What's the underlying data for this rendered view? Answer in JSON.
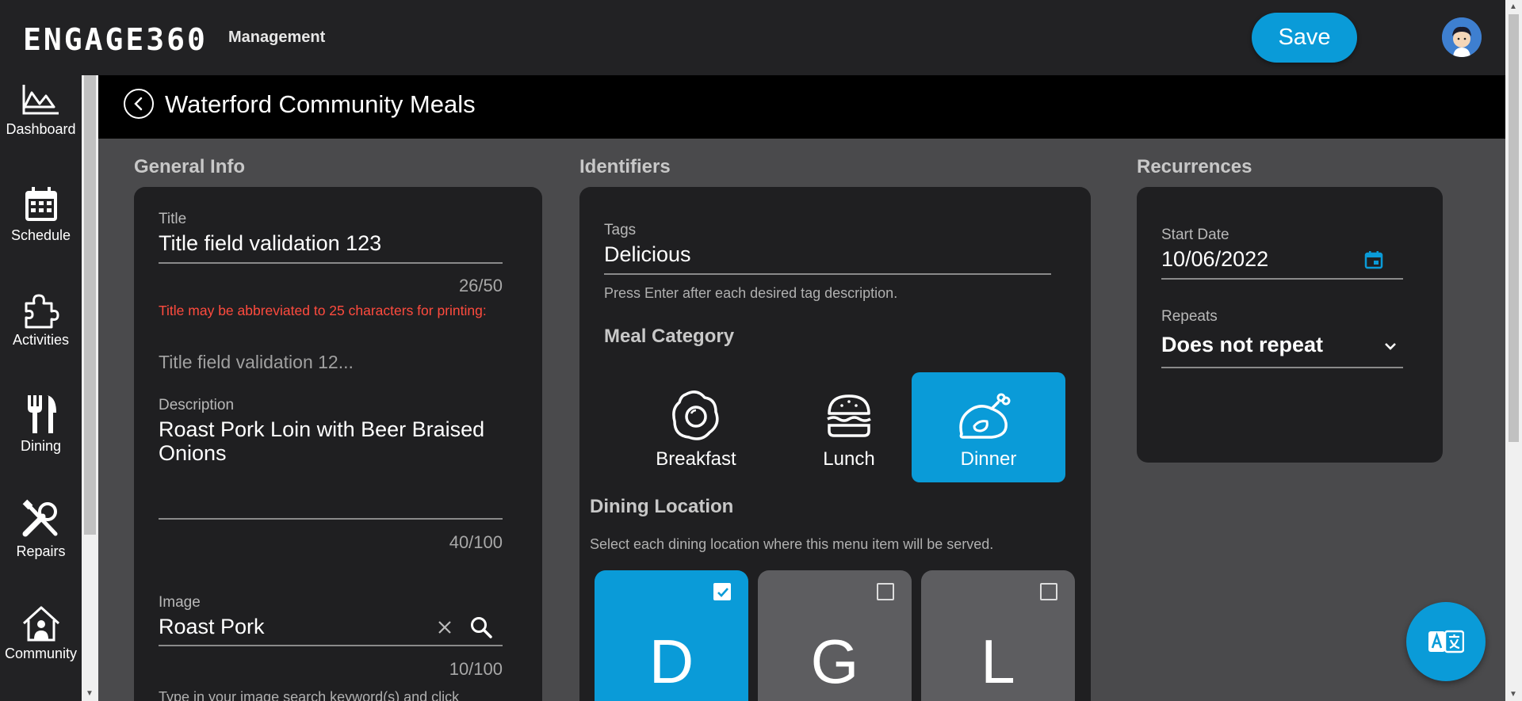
{
  "app": {
    "brand": "ENGAGE360",
    "brand_sub": "Management",
    "save_label": "Save"
  },
  "sidebar": {
    "items": [
      {
        "label": "Dashboard",
        "icon": "chart-icon"
      },
      {
        "label": "Schedule",
        "icon": "calendar-icon"
      },
      {
        "label": "Activities",
        "icon": "puzzle-icon"
      },
      {
        "label": "Dining",
        "icon": "fork-knife-icon"
      },
      {
        "label": "Repairs",
        "icon": "tools-icon"
      },
      {
        "label": "Community",
        "icon": "house-icon"
      }
    ]
  },
  "header": {
    "title": "Waterford Community Meals"
  },
  "general_info": {
    "section_title": "General Info",
    "title_label": "Title",
    "title_value": "Title field validation 123",
    "title_counter": "26/50",
    "title_warning": "Title may be abbreviated to 25 characters for printing:",
    "title_preview": "Title field validation 12...",
    "description_label": "Description",
    "description_value": "Roast Pork Loin with Beer Braised Onions",
    "description_counter": "40/100",
    "image_label": "Image",
    "image_value": "Roast Pork",
    "image_counter": "10/100",
    "image_hint": "Type in your image search keyword(s) and click"
  },
  "identifiers": {
    "section_title": "Identifiers",
    "tags_label": "Tags",
    "tags_value": "Delicious",
    "tags_hint": "Press Enter after each desired tag description.",
    "meal_category_title": "Meal Category",
    "meals": [
      {
        "label": "Breakfast",
        "icon": "fried-egg-icon",
        "selected": false
      },
      {
        "label": "Lunch",
        "icon": "burger-icon",
        "selected": false
      },
      {
        "label": "Dinner",
        "icon": "roast-chicken-icon",
        "selected": true
      }
    ],
    "dining_location_title": "Dining Location",
    "dining_location_hint": "Select each dining location where this menu item will be served.",
    "locations": [
      {
        "letter": "D",
        "checked": true
      },
      {
        "letter": "G",
        "checked": false
      },
      {
        "letter": "L",
        "checked": false
      }
    ]
  },
  "recurrences": {
    "section_title": "Recurrences",
    "start_date_label": "Start Date",
    "start_date_value": "10/06/2022",
    "repeats_label": "Repeats",
    "repeats_value": "Does not repeat"
  },
  "colors": {
    "accent": "#0a9bd8",
    "warning": "#ff4b3e",
    "card": "#1f1f21",
    "background": "#4a4a4c"
  }
}
